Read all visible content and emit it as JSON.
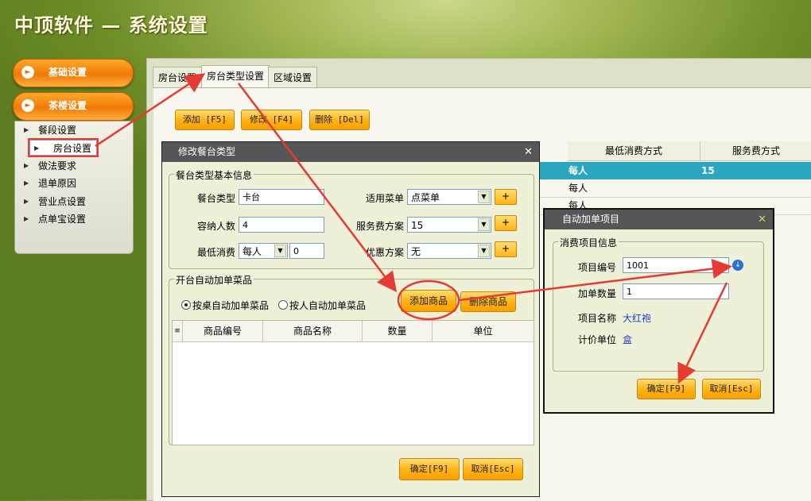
{
  "app": {
    "title": "中顶软件 — 系统设置"
  },
  "nav": {
    "basic_label": "基础设置",
    "tea_label": "茶楼设置",
    "items": [
      {
        "label": "餐段设置"
      },
      {
        "label": "房台设置"
      },
      {
        "label": "做法要求"
      },
      {
        "label": "退单原因"
      },
      {
        "label": "营业点设置"
      },
      {
        "label": "点单宝设置"
      }
    ]
  },
  "tabs": [
    {
      "label": "房台设置"
    },
    {
      "label": "房台类型设置"
    },
    {
      "label": "区域设置"
    }
  ],
  "toolbar": {
    "add": "添加 [F5]",
    "edit": "修改 [F4]",
    "delete": "删除 [Del]"
  },
  "grid": {
    "columns": [
      "最低消费方式",
      "服务费方式"
    ],
    "rows": [
      {
        "min_mode": "每人",
        "service": "15"
      },
      {
        "min_mode": "每人",
        "service": ""
      },
      {
        "min_mode": "每人",
        "service": ""
      }
    ]
  },
  "edit_dialog": {
    "title": "修改餐台类型",
    "basic_group": "餐台类型基本信息",
    "type_label": "餐台类型",
    "type_value": "卡台",
    "capacity_label": "容纳人数",
    "capacity_value": "4",
    "min_label": "最低消费",
    "min_mode": "每人",
    "min_value": "0",
    "menu_label": "适用菜单",
    "menu_value": "点菜单",
    "service_label": "服务费方案",
    "service_value": "15",
    "discount_label": "优惠方案",
    "discount_value": "无",
    "plus": "+",
    "auto_group": "开台自动加单菜品",
    "radio_table": "按桌自动加单菜品",
    "radio_person": "按人自动加单菜品",
    "add_goods": "添加商品",
    "del_goods": "删除商品",
    "columns": [
      "商品编号",
      "商品名称",
      "数量",
      "单位"
    ],
    "ok": "确定[F9]",
    "cancel": "取消[Esc]"
  },
  "auto_dialog": {
    "title": "自动加单项目",
    "group": "消费项目信息",
    "code_label": "项目编号",
    "code_value": "1001",
    "qty_label": "加单数量",
    "qty_value": "1",
    "name_label": "项目名称",
    "name_value": "大红袍",
    "unit_label": "计价单位",
    "unit_value": "盒",
    "ok": "确定[F9]",
    "cancel": "取消[Esc]"
  },
  "colors": {
    "accent_orange": "#f5a000",
    "annotation_red": "#e53b32",
    "grid_selected": "#2aa6c1"
  }
}
